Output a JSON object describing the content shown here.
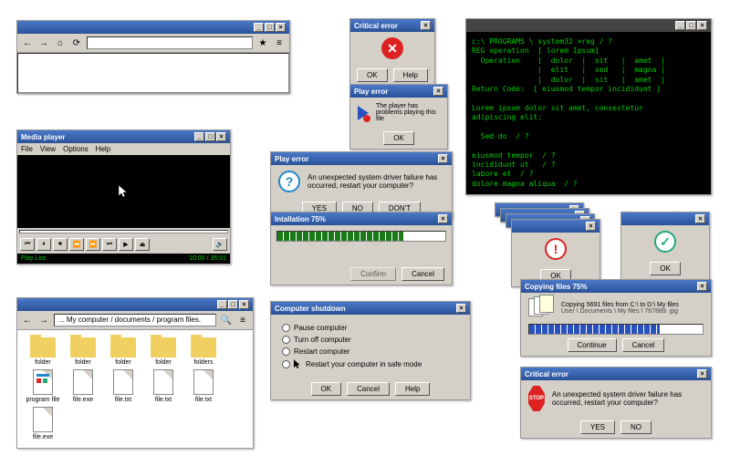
{
  "browser": {
    "addr": "",
    "star": "★"
  },
  "media": {
    "title": "Media player",
    "menu": [
      "File",
      "View",
      "Options",
      "Help"
    ],
    "playlist": "Play List",
    "time": "10:00 / 35:01"
  },
  "critical1": {
    "title": "Critical error",
    "ok": "OK",
    "help": "Help"
  },
  "play1": {
    "title": "Play error",
    "msg": "The player has problems playing this file",
    "ok": "OK"
  },
  "play2": {
    "title": "Play error",
    "msg": "An unexpected system driver failure has occurred, restart your computer?",
    "yes": "YES",
    "no": "NO",
    "dont": "DON'T"
  },
  "install": {
    "title": "Intallation 75%",
    "pct": 75,
    "confirm": "Confirm",
    "cancel": "Cancel"
  },
  "terminal": {
    "lines": [
      "c:\\ PROGRAMS \\ system32 >reg / ?",
      "REG operation  [ lorem Ipsum]",
      "  Operation    [  dolor  |  sit   |  amet  |",
      "               |  elit   |  sed   |  magna |",
      "               |  dolor  |  sit   |  amet  |",
      "Return Code:  [ eiusmod tempor incididunt ]",
      "",
      "Lorem ipsum dolor sit amet, consectetur",
      "adipiscing elit:",
      "",
      "  Sed do  / ?",
      "",
      "eiusmod tempor  / ?",
      "incididunt ut   / ?",
      "labore et  / ?",
      "dolore magna aliqua  / ?"
    ]
  },
  "warn": {
    "ok": "OK"
  },
  "okdlg": {
    "ok": "OK"
  },
  "copy": {
    "title": "Copying files 75%",
    "msg": "Copying  5691 files from C:\\  to  D:\\ My files",
    "path": "User \\ Documents \\ My files \\ 767889. jpg",
    "pct": 75,
    "cont": "Continue",
    "cancel": "Cancel"
  },
  "shutdown": {
    "title": "Computer shutdown",
    "opts": [
      "Pause computer",
      "Turn off computer",
      "Restart computer",
      "Restart your computer in safe mode"
    ],
    "ok": "OK",
    "cancel": "Cancel",
    "help": "Help"
  },
  "critical2": {
    "title": "Critical error",
    "msg": "An unexpected system driver failure has occurred, restart your computer?",
    "yes": "YES",
    "no": "NO"
  },
  "explorer": {
    "path": "... My computer / documents / program files.",
    "items": [
      {
        "name": "folder",
        "type": "folder"
      },
      {
        "name": "folder",
        "type": "folder"
      },
      {
        "name": "folder",
        "type": "folder"
      },
      {
        "name": "folder",
        "type": "folder"
      },
      {
        "name": "folders",
        "type": "folder"
      },
      {
        "name": "program file",
        "type": "app"
      },
      {
        "name": "file.exe",
        "type": "file"
      },
      {
        "name": "file.txt",
        "type": "file"
      },
      {
        "name": "file.txt",
        "type": "file"
      },
      {
        "name": "file.txt",
        "type": "file"
      },
      {
        "name": "file.exe",
        "type": "file"
      }
    ]
  }
}
